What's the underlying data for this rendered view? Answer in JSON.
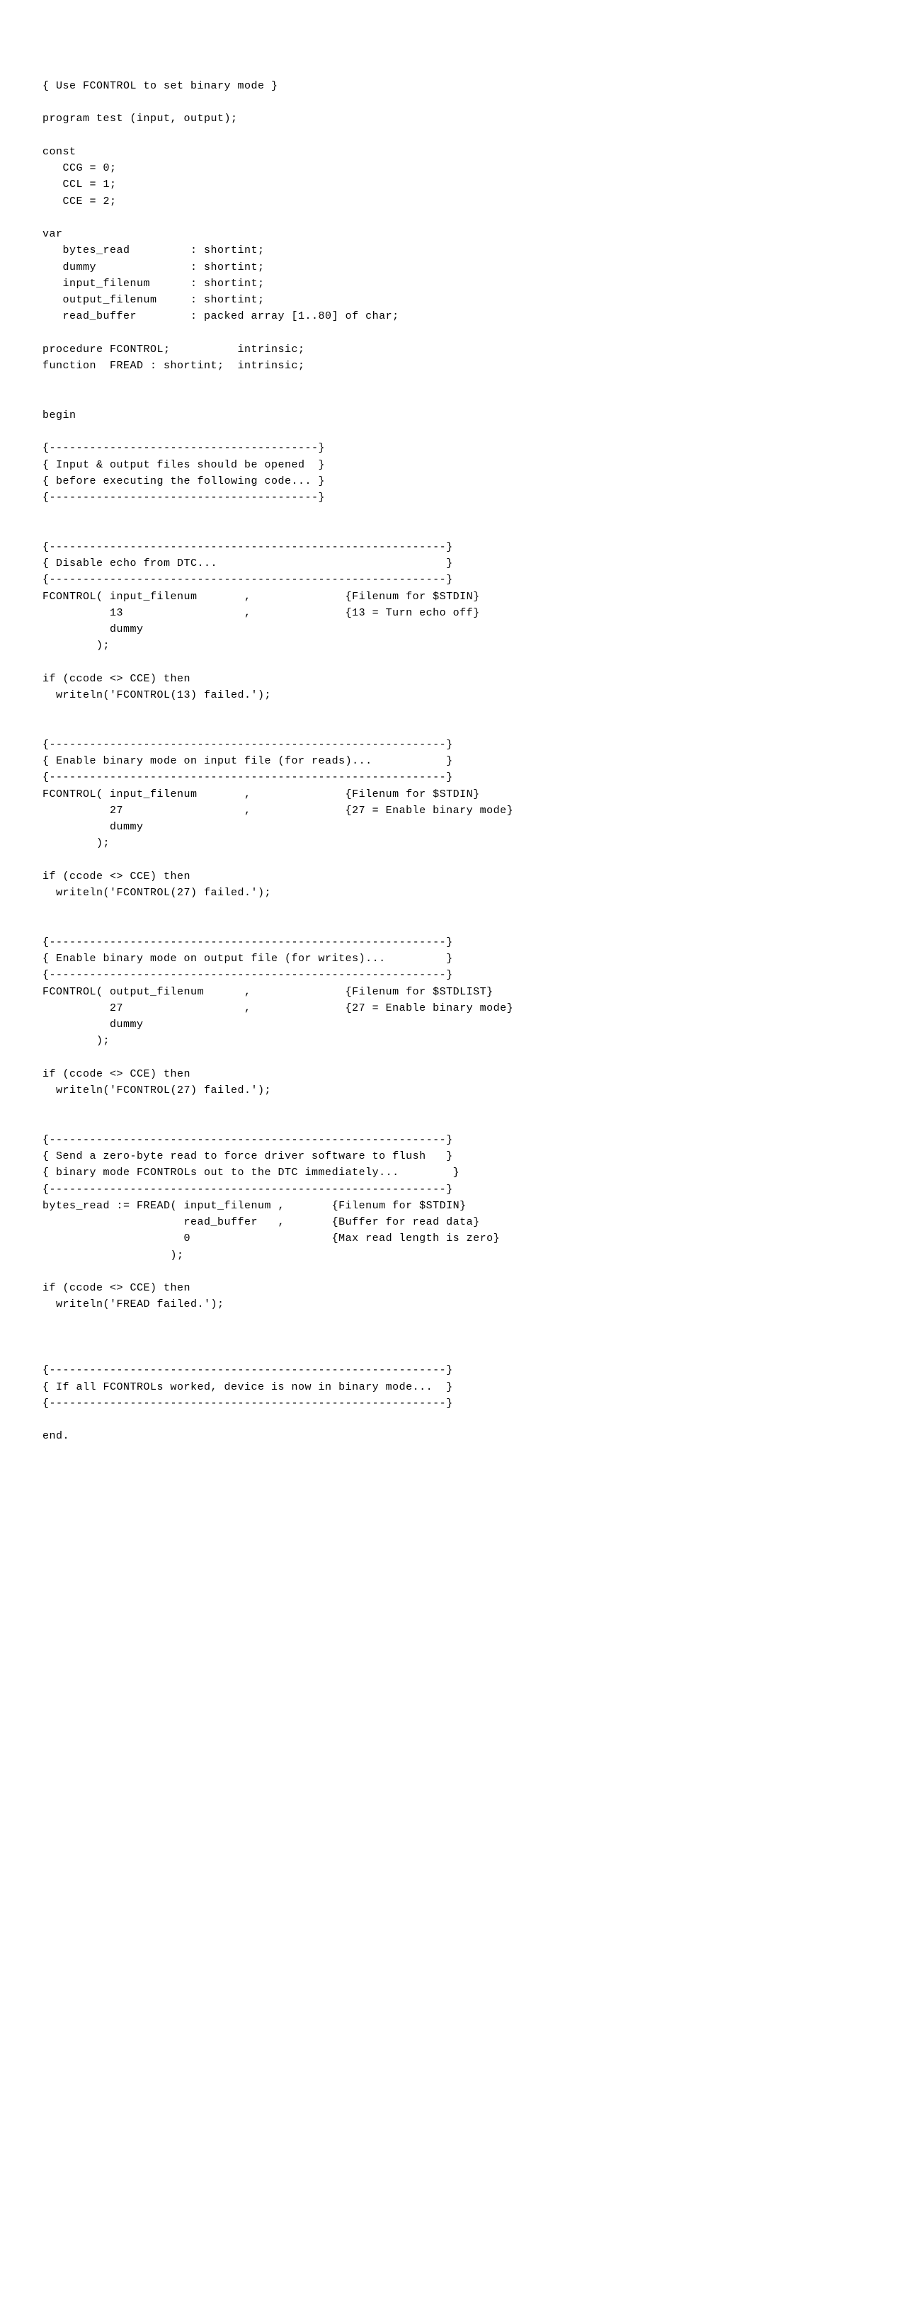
{
  "lines": [
    "{ Use FCONTROL to set binary mode }",
    "",
    "program test (input, output);",
    "",
    "const",
    "   CCG = 0;",
    "   CCL = 1;",
    "   CCE = 2;",
    "",
    "var",
    "   bytes_read         : shortint;",
    "   dummy              : shortint;",
    "   input_filenum      : shortint;",
    "   output_filenum     : shortint;",
    "   read_buffer        : packed array [1..80] of char;",
    "",
    "procedure FCONTROL;          intrinsic;",
    "function  FREAD : shortint;  intrinsic;",
    "",
    "",
    "begin",
    "",
    "{----------------------------------------}",
    "{ Input & output files should be opened  }",
    "{ before executing the following code... }",
    "{----------------------------------------}",
    "",
    "",
    "{-----------------------------------------------------------}",
    "{ Disable echo from DTC...                                  }",
    "{-----------------------------------------------------------}",
    "FCONTROL( input_filenum       ,              {Filenum for $STDIN}",
    "          13                  ,              {13 = Turn echo off}",
    "          dummy",
    "        );",
    "",
    "if (ccode <> CCE) then",
    "  writeln('FCONTROL(13) failed.');",
    "",
    "",
    "{-----------------------------------------------------------}",
    "{ Enable binary mode on input file (for reads)...           }",
    "{-----------------------------------------------------------}",
    "FCONTROL( input_filenum       ,              {Filenum for $STDIN}",
    "          27                  ,              {27 = Enable binary mode}",
    "          dummy",
    "        );",
    "",
    "if (ccode <> CCE) then",
    "  writeln('FCONTROL(27) failed.');",
    "",
    "",
    "{-----------------------------------------------------------}",
    "{ Enable binary mode on output file (for writes)...         }",
    "{-----------------------------------------------------------}",
    "FCONTROL( output_filenum      ,              {Filenum for $STDLIST}",
    "          27                  ,              {27 = Enable binary mode}",
    "          dummy",
    "        );",
    "",
    "if (ccode <> CCE) then",
    "  writeln('FCONTROL(27) failed.');",
    "",
    "",
    "{-----------------------------------------------------------}",
    "{ Send a zero-byte read to force driver software to flush   }",
    "{ binary mode FCONTROLs out to the DTC immediately...        }",
    "{-----------------------------------------------------------}",
    "bytes_read := FREAD( input_filenum ,       {Filenum for $STDIN}",
    "                     read_buffer   ,       {Buffer for read data}",
    "                     0                     {Max read length is zero}",
    "                   );",
    "",
    "if (ccode <> CCE) then",
    "  writeln('FREAD failed.');",
    "",
    "",
    "",
    "{-----------------------------------------------------------}",
    "{ If all FCONTROLs worked, device is now in binary mode...  }",
    "{-----------------------------------------------------------}",
    "",
    "end."
  ]
}
